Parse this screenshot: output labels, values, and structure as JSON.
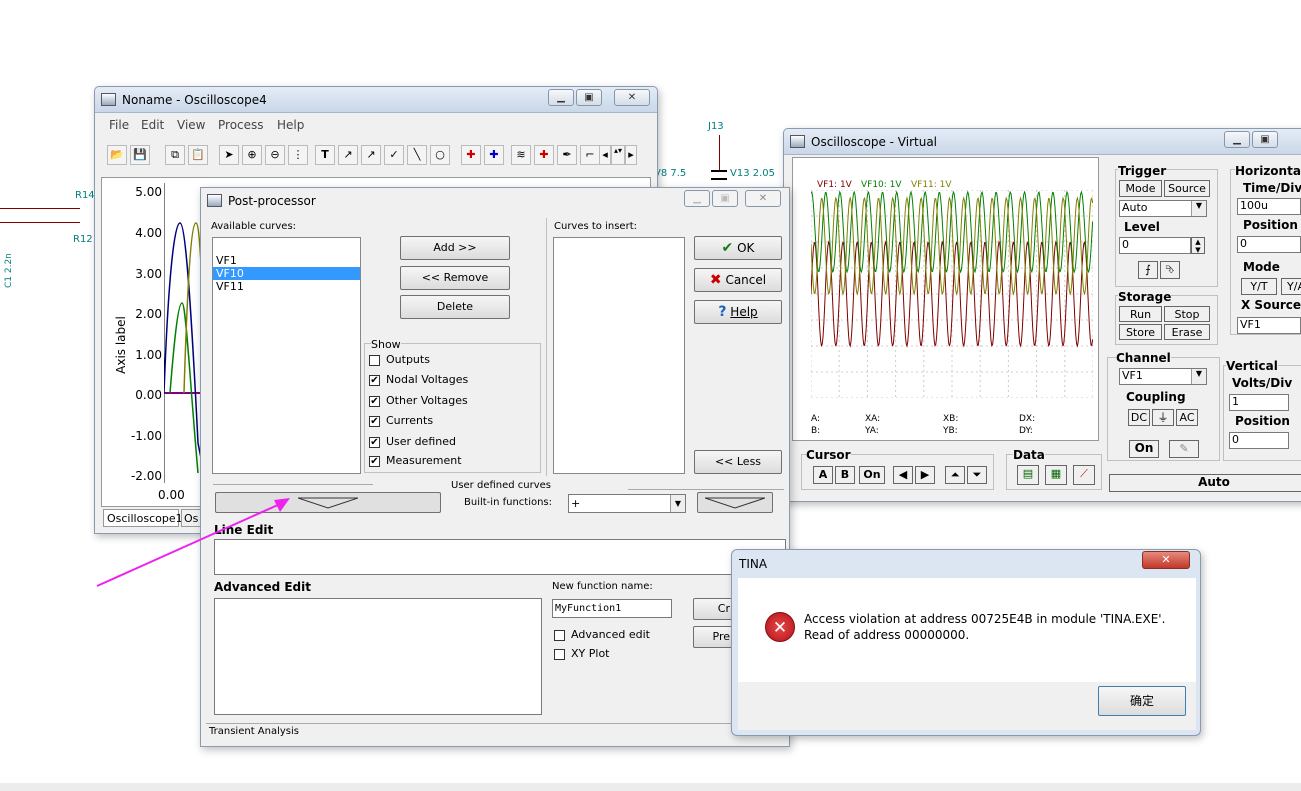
{
  "schematic": {
    "j13": "J13",
    "v13": "V13 2.05",
    "v8": "V8 7.5",
    "r14": "R14",
    "r12": "R12",
    "c1": "C1 2.2n"
  },
  "osc4": {
    "title": "Noname - Oscilloscope4",
    "menu": [
      "File",
      "Edit",
      "View",
      "Process",
      "Help"
    ],
    "y_axis_label": "Axis label",
    "y_ticks": [
      "5.00",
      "4.00",
      "3.00",
      "2.00",
      "1.00",
      "0.00",
      "-1.00",
      "-2.00"
    ],
    "x_tick": "0.00",
    "tabs": [
      "Oscilloscope1",
      "Os"
    ]
  },
  "post": {
    "title": "Post-processor",
    "available_label": "Available curves:",
    "curves": [
      "VF1",
      "VF10",
      "VF11"
    ],
    "selected_curve": "VF10",
    "add_btn": "Add >>",
    "remove_btn": "<< Remove",
    "delete_btn": "Delete",
    "show_label": "Show",
    "show_items": [
      {
        "label": "Outputs",
        "checked": false
      },
      {
        "label": "Nodal Voltages",
        "checked": true
      },
      {
        "label": "Other Voltages",
        "checked": true
      },
      {
        "label": "Currents",
        "checked": true
      },
      {
        "label": "User defined",
        "checked": true
      },
      {
        "label": "Measurement",
        "checked": true
      }
    ],
    "insert_label": "Curves to insert:",
    "ok_btn": "OK",
    "cancel_btn": "Cancel",
    "help_btn": "Help",
    "less_btn": "<< Less",
    "udc_label": "User defined curves",
    "builtin_label": "Built-in functions:",
    "builtin_value": "+",
    "line_edit_label": "Line Edit",
    "adv_edit_label": "Advanced Edit",
    "new_fn_label": "New function name:",
    "new_fn_value": "MyFunction1",
    "adv_edit_cb": "Advanced edit",
    "xy_plot_cb": "XY Plot",
    "create_btn": "Cr",
    "pre_btn": "Pre",
    "status": "Transient Analysis"
  },
  "vosc": {
    "title": "Oscilloscope - Virtual",
    "legend": [
      "VF1: 1V",
      "VF10: 1V",
      "VF11: 1V"
    ],
    "readout": {
      "a": "A:",
      "b": "B:",
      "xa": "XA:",
      "ya": "YA:",
      "xb": "XB:",
      "yb": "YB:",
      "dx": "DX:",
      "dy": "DY:"
    },
    "trigger": "Trigger",
    "mode": "Mode",
    "source": "Source",
    "trig_value": "Auto",
    "level": "Level",
    "level_value": "0",
    "storage": "Storage",
    "run": "Run",
    "stop": "Stop",
    "store": "Store",
    "erase": "Erase",
    "channel": "Channel",
    "channel_value": "VF1",
    "coupling": "Coupling",
    "dc": "DC",
    "ac": "AC",
    "on": "On",
    "horizontal": "Horizontal",
    "time_div": "Time/Div",
    "time_div_value": "100u",
    "position": "Position",
    "h_pos_value": "0",
    "hmode": "Mode",
    "yt": "Y/T",
    "ya_btn": "Y/A",
    "xsource": "X Source",
    "xsource_value": "VF1",
    "vertical": "Vertical",
    "volts_div": "Volts/Div",
    "volts_div_value": "1",
    "v_position": "Position",
    "v_pos_value": "0",
    "cursor": "Cursor",
    "cursor_a": "A",
    "cursor_b": "B",
    "cursor_on": "On",
    "data": "Data",
    "auto": "Auto"
  },
  "error": {
    "title": "TINA",
    "line1": "Access violation at address 00725E4B in module 'TINA.EXE'.",
    "line2": "Read of address 00000000.",
    "ok": "确定"
  },
  "colors": {
    "accent": "#3399ff",
    "arrow": "#ee22ee",
    "error_red": "#c4161c"
  }
}
